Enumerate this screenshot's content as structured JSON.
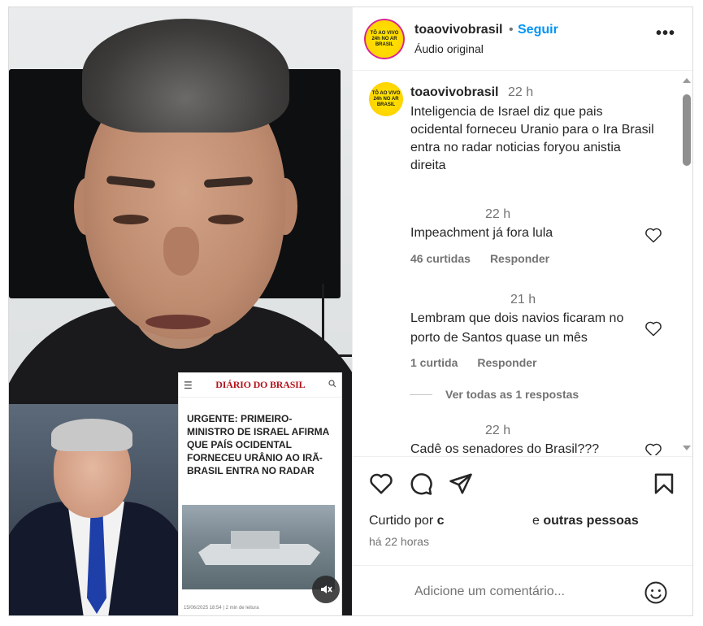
{
  "header": {
    "username": "toaovivobrasil",
    "separator": "•",
    "follow_label": "Seguir",
    "audio_label": "Áudio original",
    "more_label": "•••",
    "avatar_text": "TÔ AO VIVO 24h NO AR BRASIL"
  },
  "caption": {
    "username": "toaovivobrasil",
    "time": "22 h",
    "text": "Inteligencia de Israel diz que pais ocidental forneceu Uranio para o Ira Brasil entra no radar noticias foryou anistia direita"
  },
  "comments": [
    {
      "time": "22 h",
      "text": "Impeachment já fora lula",
      "likes": "46 curtidas",
      "reply": "Responder"
    },
    {
      "time": "21 h",
      "text": "Lembram que dois navios ficaram no porto de Santos quase un mês",
      "likes": "1 curtida",
      "reply": "Responder"
    },
    {
      "time": "22 h",
      "text": "Cadê os senadores do Brasil???"
    }
  ],
  "view_replies": "Ver todas as 1 respostas",
  "likes_line": {
    "prefix": "Curtido por",
    "partial_name": "c",
    "suffix_e": "e",
    "others": "outras pessoas"
  },
  "posted_ago": "há 22 horas",
  "comment_input": {
    "placeholder": "Adicione um comentário..."
  },
  "news_card": {
    "logo": "DIÁRIO DO BRASIL",
    "headline": "URGENTE: PRIMEIRO-MINISTRO DE ISRAEL AFIRMA QUE PAÍS OCIDENTAL FORNECEU URÂNIO AO IRÃ- BRASIL ENTRA NO RADAR",
    "footer": "15/06/2025 18:54 | 2 min de leitura"
  },
  "icons": {
    "more": "more-icon",
    "heart": "heart-icon",
    "comment": "comment-icon",
    "share": "share-icon",
    "save": "bookmark-icon",
    "emoji": "emoji-icon",
    "mute": "muted-icon"
  },
  "colors": {
    "accent": "#0095f6",
    "text": "#262626",
    "muted": "#737373",
    "border": "#dbdbdb"
  }
}
